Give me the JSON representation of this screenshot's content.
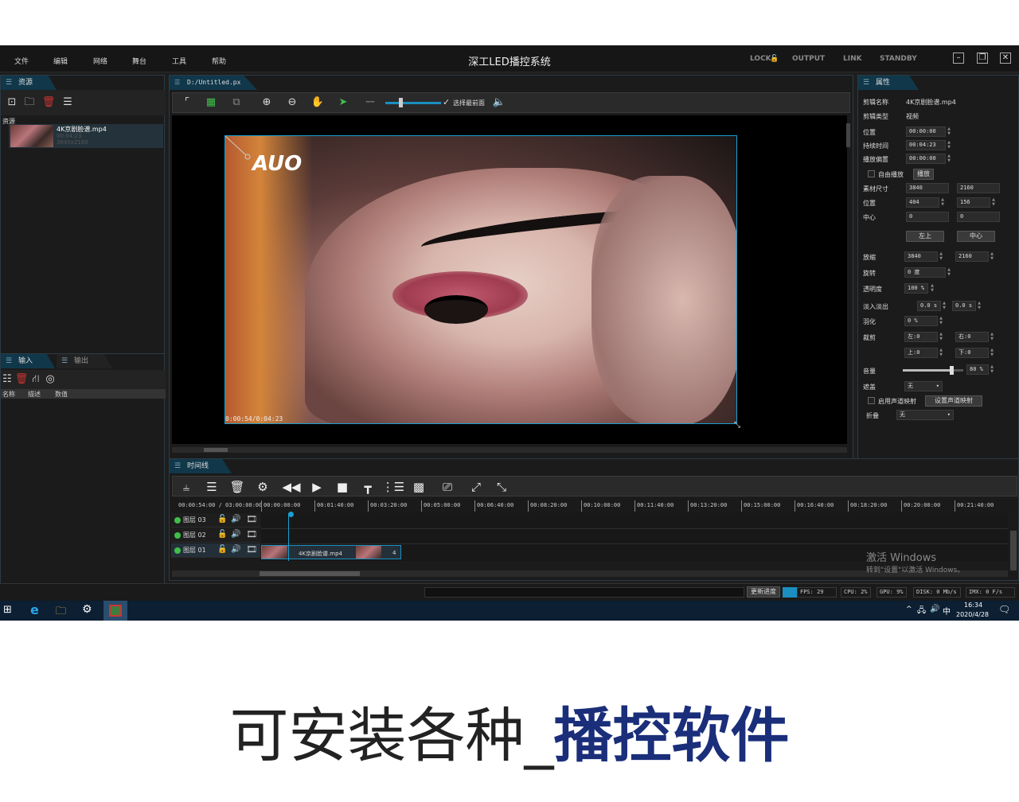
{
  "app": {
    "title": "深工LED播控系统",
    "menu": [
      "文件",
      "编辑",
      "网络",
      "舞台",
      "工具",
      "帮助"
    ],
    "right_labels": [
      "LOCK",
      "OUTPUT",
      "LINK",
      "STANDBY"
    ]
  },
  "resources": {
    "tab": "资源",
    "header": "资源",
    "item": {
      "name": "4K京剧脸谱.mp4",
      "duration": "00:04:23",
      "size": "3840x2160"
    }
  },
  "io": {
    "tab_in": "输入",
    "tab_out": "输出",
    "columns": [
      "名称",
      "描述",
      "数值"
    ]
  },
  "preview": {
    "tab": "D:/Untitled.px",
    "keep_front_label": "选择最前面",
    "logo": "AUO",
    "timecode": "0:00:54/0:04:23"
  },
  "properties": {
    "tab": "属性",
    "clip_name_label": "剪辑名称",
    "clip_name": "4K京剧脸谱.mp4",
    "clip_type_label": "剪辑类型",
    "clip_type": "视频",
    "position_time_label": "位置",
    "position_time": "00:00:00",
    "duration_label": "持续时间",
    "duration": "00:04:23",
    "play_offset_label": "播放偏置",
    "play_offset": "00:00:00",
    "free_play_label": "自由播放",
    "play_button": "播放",
    "src_size_label": "素材尺寸",
    "src_w": "3840",
    "src_h": "2160",
    "pos_label": "位置",
    "pos_x": "404",
    "pos_y": "156",
    "center_label": "中心",
    "center_x": "0",
    "center_y": "0",
    "top_left_button": "左上",
    "center_button": "中心",
    "scale_label": "放缩",
    "scale_w": "3840",
    "scale_h": "2160",
    "rotate_label": "旋转",
    "rotate": "0 度",
    "opacity_label": "透明度",
    "opacity": "100 %",
    "fade_label": "淡入淡出",
    "fade_in": "0.0 s",
    "fade_out": "0.0 s",
    "feather_label": "羽化",
    "feather": "0 %",
    "crop_label": "裁剪",
    "crop_left": "左:0",
    "crop_right": "右:0",
    "crop_top": "上:0",
    "crop_bottom": "下:0",
    "volume_label": "音量",
    "volume": "80 %",
    "volume_level": 0.8,
    "mask_label": "遮盖",
    "mask": "无",
    "audio_map_label": "启用声道映射",
    "audio_map_button": "设置声道映射",
    "fold_label": "折叠",
    "fold": "无"
  },
  "timeline": {
    "tab": "时间线",
    "time_display": "00:00:54:00 / 03:00:00:00",
    "ticks": [
      "00:00:00:00",
      "00:01:40:00",
      "00:03:20:00",
      "00:05:00:00",
      "00:06:40:00",
      "00:08:20:00",
      "00:10:00:00",
      "00:11:40:00",
      "00:13:20:00",
      "00:15:00:00",
      "00:16:40:00",
      "00:18:20:00",
      "00:20:00:00",
      "00:21:40:00"
    ],
    "layers": [
      {
        "label": "图层 03"
      },
      {
        "label": "图层 02"
      },
      {
        "label": "图层 01"
      }
    ],
    "clip_label": "4K京剧脸谱.mp4",
    "clip_count": "4"
  },
  "status": {
    "update_label": "更新进度",
    "fps": "FPS: 29",
    "cpu": "CPU: 2%",
    "gpu": "GPU: 9%",
    "disk": "DISK: 0 Mb/s",
    "imx": "IMX: 0 F/s"
  },
  "watermark": {
    "line1": "激活 Windows",
    "line2": "转到\"设置\"以激活 Windows。"
  },
  "taskbar": {
    "ime": "中",
    "time": "16:34",
    "date": "2020/4/28"
  },
  "caption": {
    "normal": "可安装各种_",
    "highlight": "播控软件"
  },
  "colors": {
    "accent": "#1a8fc0",
    "highlight_text": "#1a2e7a"
  }
}
